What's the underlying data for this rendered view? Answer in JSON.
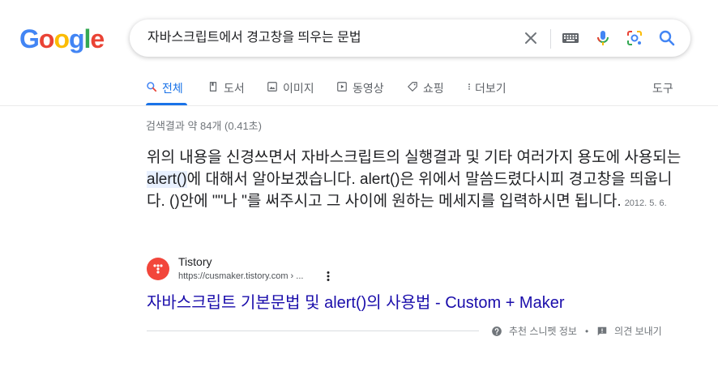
{
  "logo": {
    "letters": [
      "G",
      "o",
      "o",
      "g",
      "l",
      "e"
    ],
    "colors": [
      "#4285f4",
      "#ea4335",
      "#fbbc05",
      "#4285f4",
      "#34a853",
      "#ea4335"
    ]
  },
  "search": {
    "query": "자바스크립트에서 경고창을 띄우는 문법",
    "icons": [
      "close-icon",
      "keyboard-icon",
      "microphone-icon",
      "lens-icon",
      "search-icon"
    ]
  },
  "tabs": [
    {
      "label": "전체",
      "icon": "search-icon",
      "active": true
    },
    {
      "label": "도서",
      "icon": "book-icon"
    },
    {
      "label": "이미지",
      "icon": "image-icon"
    },
    {
      "label": "동영상",
      "icon": "play-icon"
    },
    {
      "label": "쇼핑",
      "icon": "tag-icon"
    },
    {
      "label": "더보기",
      "icon": "more-icon"
    }
  ],
  "tools_label": "도구",
  "result_stats": "검색결과 약 84개 (0.41초)",
  "featured_snippet": {
    "text_before": "위의 내용을 신경쓰면서 자바스크립트의 실행결과 및 기타 여러가지 용도에 사용되는 ",
    "highlight": "alert()",
    "text_after": "에 대해서 알아보겠습니다. alert()은 위에서 말씀드렸다시피 경고창을 띄웁니다. ()안에 \"\"나 \"를 써주시고 그 사이에 원하는 메세지를 입력하시면 됩니다.",
    "date": "2012. 5. 6."
  },
  "source": {
    "name": "Tistory",
    "url": "https://cusmaker.tistory.com › ...",
    "favicon_color": "#f2463b"
  },
  "result_title": "자바스크립트 기본문법 및 alert()의 사용법 - Custom + Maker",
  "footer": {
    "snippet_info": "추천 스니펫 정보",
    "separator": "•",
    "feedback": "의견 보내기"
  }
}
